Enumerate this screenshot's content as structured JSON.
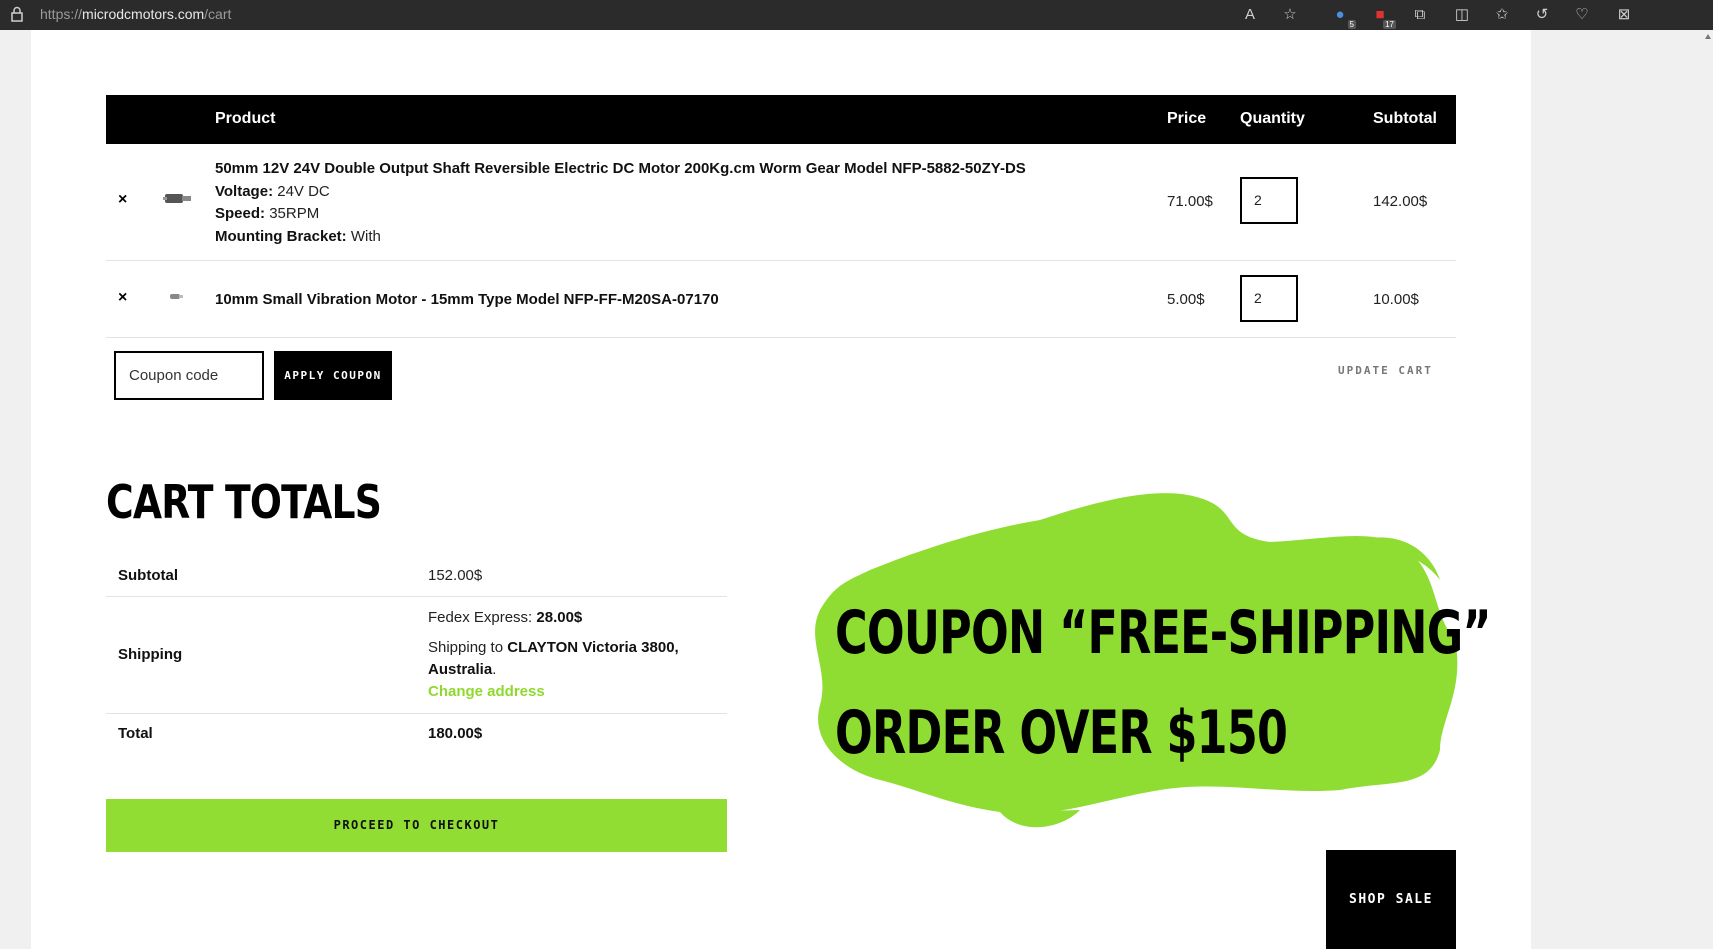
{
  "browser": {
    "url_prefix": "https://",
    "url_host": "microdcmotors.com",
    "url_path": "/cart",
    "badges": {
      "ext1": "5",
      "ext2": "17"
    }
  },
  "cart": {
    "headers": {
      "product": "Product",
      "price": "Price",
      "quantity": "Quantity",
      "subtotal": "Subtotal"
    },
    "items": [
      {
        "remove": "×",
        "name": "50mm 12V 24V Double Output Shaft Reversible Electric DC Motor 200Kg.cm Worm Gear Model NFP-5882-50ZY-DS",
        "attrs": [
          {
            "label": "Voltage:",
            "value": "24V DC"
          },
          {
            "label": "Speed:",
            "value": "35RPM"
          },
          {
            "label": "Mounting Bracket:",
            "value": "With"
          }
        ],
        "price": "71.00$",
        "qty": "2",
        "subtotal": "142.00$"
      },
      {
        "remove": "×",
        "name": "10mm Small Vibration Motor - 15mm Type Model NFP-FF-M20SA-07170",
        "price": "5.00$",
        "qty": "2",
        "subtotal": "10.00$"
      }
    ],
    "coupon_placeholder": "Coupon code",
    "apply_coupon": "APPLY COUPON",
    "update_cart": "UPDATE CART"
  },
  "totals": {
    "title": "CART TOTALS",
    "subtotal_label": "Subtotal",
    "subtotal_value": "152.00$",
    "shipping_label": "Shipping",
    "shipping_method": "Fedex Express:",
    "shipping_cost": "28.00$",
    "shipping_to": "Shipping to",
    "shipping_place": "CLAYTON Victoria 3800,",
    "shipping_country": "Australia",
    "shipping_period": ".",
    "change_address": "Change address",
    "total_label": "Total",
    "total_value": "180.00$",
    "checkout": "PROCEED TO CHECKOUT"
  },
  "promo": {
    "line1": "COUPON “FREE-SHIPPING”",
    "line2": "ORDER OVER $150",
    "brush_color": "#8fdd33",
    "shop_sale": "SHOP SALE"
  }
}
